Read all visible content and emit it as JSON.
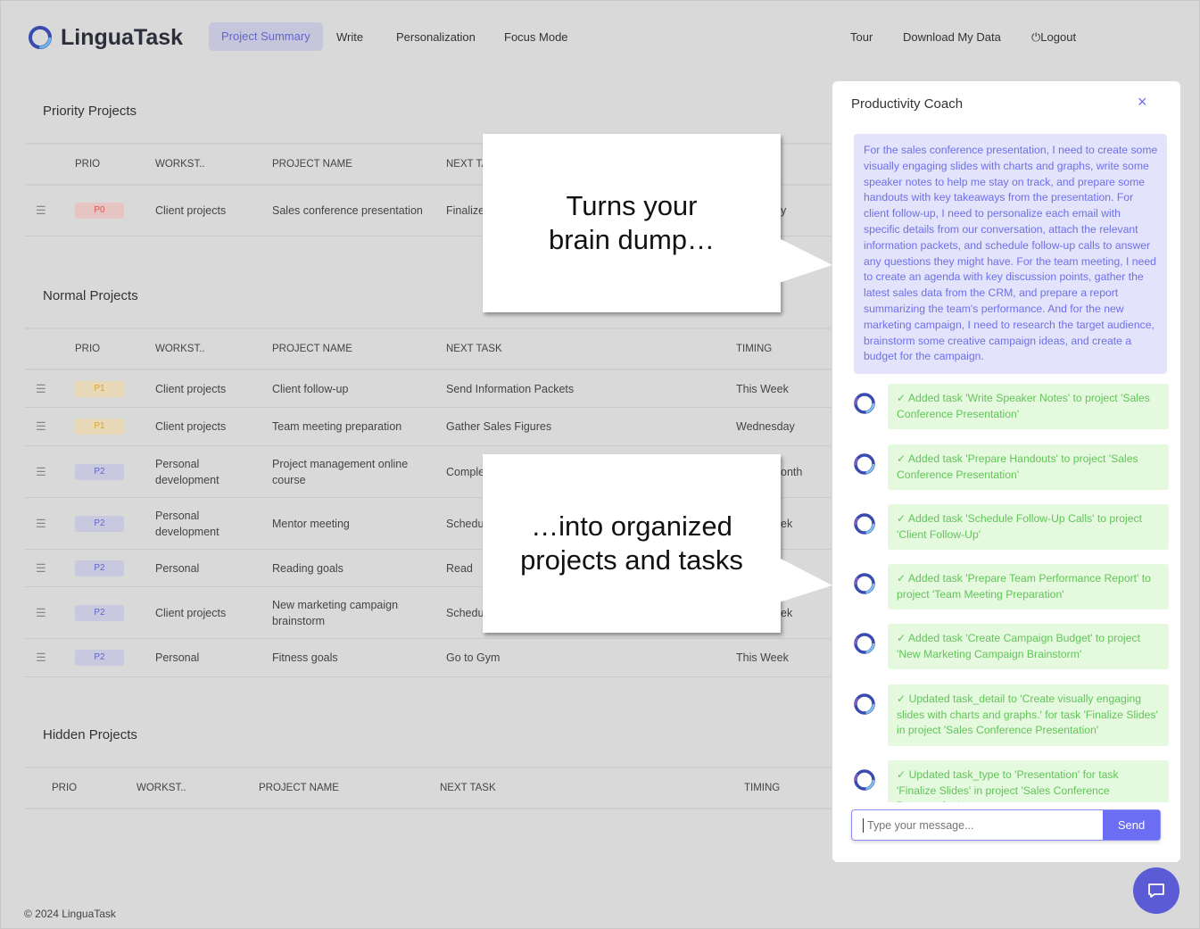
{
  "header": {
    "brand": "LinguaTask",
    "nav": [
      "Project Summary",
      "Write",
      "Personalization",
      "Focus Mode"
    ],
    "active_nav": "Project Summary",
    "right": [
      "Tour",
      "Download My Data",
      "Logout"
    ]
  },
  "columns": [
    "PRIO",
    "WORKST..",
    "PROJECT NAME",
    "NEXT TASK",
    "TIMING"
  ],
  "priority": {
    "title": "Priority Projects",
    "header_visible": [
      "PRIO",
      "WORKST..",
      "PROJECT NAME",
      "NEXT TA"
    ],
    "rows": [
      {
        "prio": "P0",
        "workstream": "Client projects",
        "project": "Sales conference presentation",
        "next": "Finalize",
        "timing": "y"
      }
    ]
  },
  "normal": {
    "title": "Normal Projects",
    "rows": [
      {
        "prio": "P1",
        "workstream": "Client projects",
        "project": "Client follow-up",
        "next": "Send Information Packets",
        "timing": "This Week"
      },
      {
        "prio": "P1",
        "workstream": "Client projects",
        "project": "Team meeting preparation",
        "next": "Gather Sales Figures",
        "timing": "Wednesday"
      },
      {
        "prio": "P2",
        "workstream": "Personal development",
        "project": "Project management online course",
        "next": "Comple",
        "timing": "onth"
      },
      {
        "prio": "P2",
        "workstream": "Personal development",
        "project": "Mentor meeting",
        "next": "Schedu",
        "timing": "ek"
      },
      {
        "prio": "P2",
        "workstream": "Personal",
        "project": "Reading goals",
        "next": "Read",
        "timing": ""
      },
      {
        "prio": "P2",
        "workstream": "Client projects",
        "project": "New marketing campaign brainstorm",
        "next": "Schedu",
        "timing": "ek"
      },
      {
        "prio": "P2",
        "workstream": "Personal",
        "project": "Fitness goals",
        "next": "Go to Gym",
        "timing": "This Week"
      }
    ]
  },
  "hidden": {
    "title": "Hidden Projects"
  },
  "callouts": [
    "Turns your brain dump…",
    "…into organized projects and tasks"
  ],
  "coach": {
    "title": "Productivity Coach",
    "close": "×",
    "user_message": "For the sales conference presentation, I need to create some visually engaging slides with charts and graphs, write some speaker notes to help me stay on track, and prepare some handouts with key takeaways from the presentation. For client follow-up, I need to personalize each email with specific details from our conversation, attach the relevant information packets, and schedule follow-up calls to answer any questions they might have. For the team meeting, I need to create an agenda with key discussion points, gather the latest sales data from the CRM, and prepare a report summarizing the team's performance. And for the new marketing campaign, I need to research the target audience, brainstorm some creative campaign ideas, and create a budget for the campaign.",
    "bot_messages": [
      "✓ Added task 'Write Speaker Notes' to project 'Sales Conference Presentation'",
      "✓ Added task 'Prepare Handouts' to project 'Sales Conference Presentation'",
      "✓ Added task 'Schedule Follow-Up Calls' to project 'Client Follow-Up'",
      "✓ Added task 'Prepare Team Performance Report' to project 'Team Meeting Preparation'",
      "✓ Added task 'Create Campaign Budget' to project 'New Marketing Campaign Brainstorm'",
      "✓ Updated task_detail to 'Create visually engaging slides with charts and graphs.' for task 'Finalize Slides' in project 'Sales Conference Presentation'",
      "✓ Updated task_type to 'Presentation' for task 'Finalize Slides' in project 'Sales Conference Presentation'"
    ],
    "input_placeholder": "Type your message...",
    "send": "Send"
  },
  "footer": "© 2024 LinguaTask",
  "colors": {
    "accent": "#6b6df2",
    "p0": "#d9534f",
    "p1": "#d9a23a",
    "p2": "#6366c9",
    "success": "#62c45a"
  }
}
